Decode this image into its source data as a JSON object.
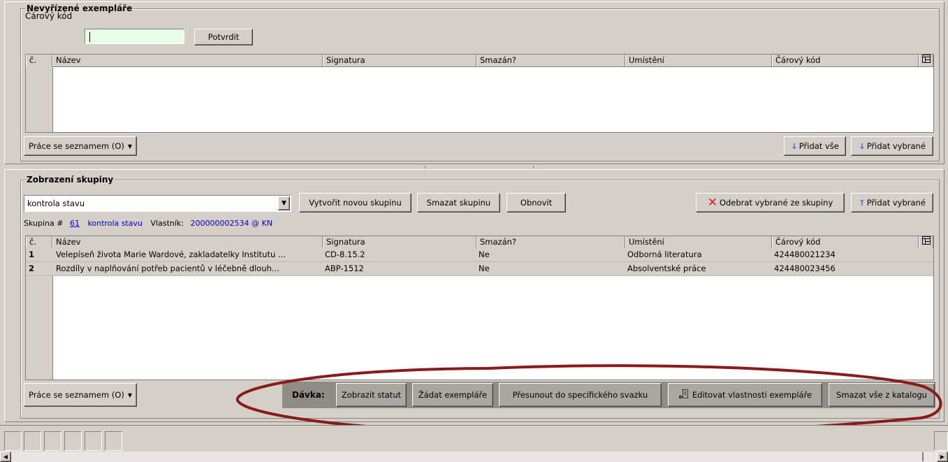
{
  "pending": {
    "title": "Nevyřízené exempláře",
    "barcode_label": "Čárový kód",
    "barcode_value": "",
    "confirm_label": "Potvrdit",
    "columns": [
      "č.",
      "Název",
      "Signatura",
      "Smazán?",
      "Umístění",
      "Čárový kód"
    ],
    "list_menu_label": "Práce se seznamem (O)",
    "add_all_label": "Přidat vše",
    "add_selected_label": "Přidat vybrané"
  },
  "group": {
    "title": "Zobrazení skupiny",
    "selected_group": "kontrola stavu",
    "create_label": "Vytvořit novou skupinu",
    "delete_label": "Smazat skupinu",
    "refresh_label": "Obnovit",
    "remove_selected_label": "Odebrat vybrané ze skupiny",
    "add_selected_label": "Přidat vybrané",
    "info_prefix": "Skupina #",
    "group_id": "61",
    "group_name": "kontrola stavu",
    "owner_label": "Vlastník:",
    "owner_value": "200000002534 @ KN",
    "columns": [
      "č.",
      "Název",
      "Signatura",
      "Smazán?",
      "Umístění",
      "Čárový kód"
    ],
    "rows": [
      {
        "num": "1",
        "title": "Velepíseň života Marie Wardové, zakladatelky Institutu ...",
        "signature": "CD-8.15.2",
        "deleted": "Ne",
        "location": "Odborná literatura",
        "barcode": "424480021234"
      },
      {
        "num": "2",
        "title": "Rozdíly v naplňování potřeb pacientů v léčebně dlouh...",
        "signature": "ABP-1512",
        "deleted": "Ne",
        "location": "Absolventské práce",
        "barcode": "424480023456"
      }
    ],
    "list_menu_label": "Práce se seznamem (O)"
  },
  "batch": {
    "label": "Dávka:",
    "show_status_label": "Zobrazit statut",
    "request_items_label": "Žádat exempláře",
    "move_label": "Přesunout do specifického svazku",
    "edit_props_label": "Editovat vlastnosti exempláře",
    "delete_all_label": "Smazat vše z katalogu"
  },
  "colors": {
    "highlight_ellipse": "#8b1a1a",
    "barcode_input_bg": "#e6ffe6",
    "link_blue": "#0000cc",
    "remove_icon": "#d42020",
    "arrow_icon": "#3a6fd8"
  }
}
